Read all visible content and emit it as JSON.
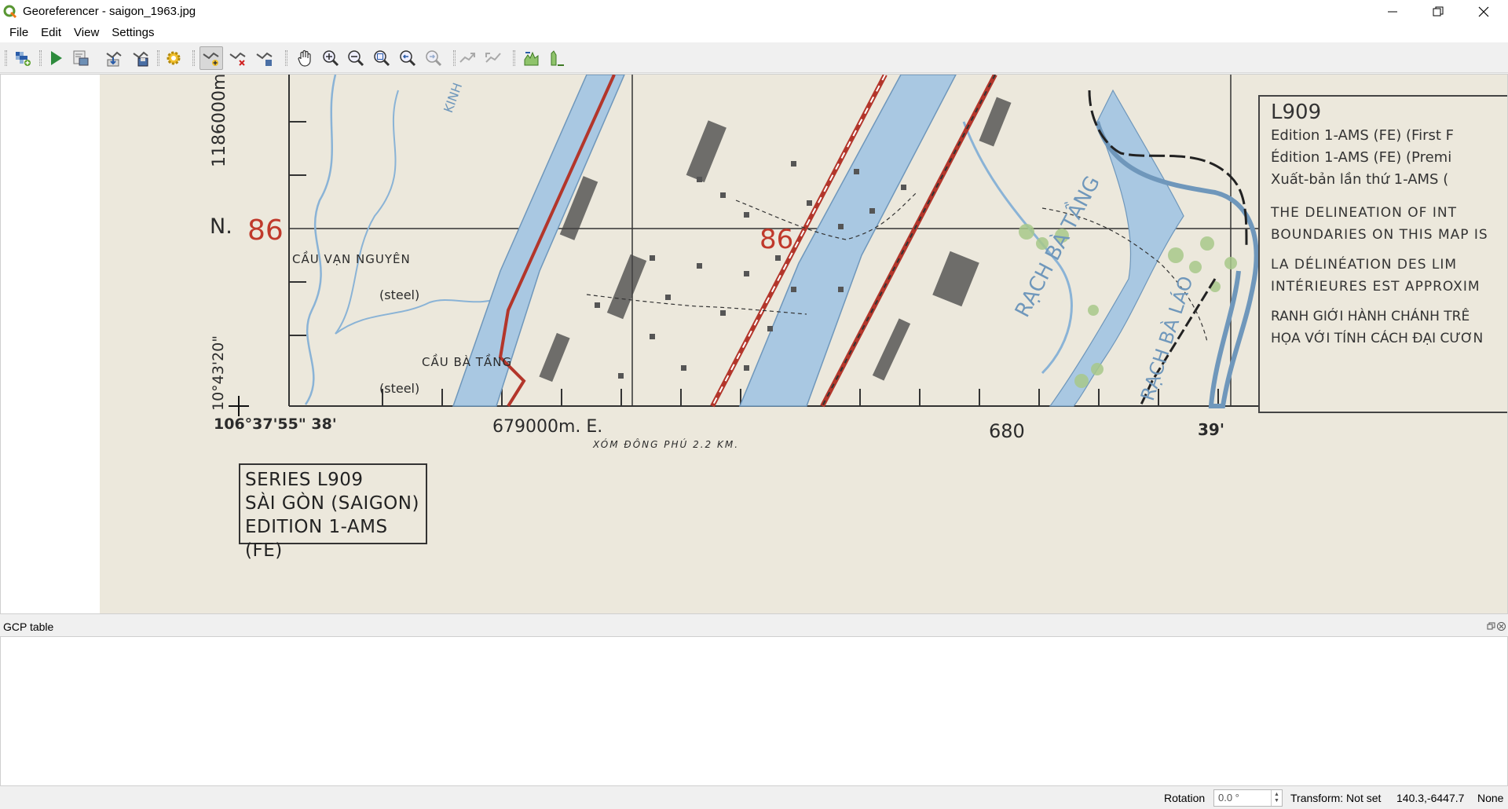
{
  "window": {
    "title": "Georeferencer - saigon_1963.jpg"
  },
  "menu": [
    "File",
    "Edit",
    "View",
    "Settings"
  ],
  "toolbar": {
    "buttons": [
      {
        "name": "open-raster",
        "icon": "open-raster-icon"
      },
      {
        "name": "start-georeferencing",
        "icon": "play-icon"
      },
      {
        "name": "generate-gdal-script",
        "icon": "gdal-script-icon"
      },
      {
        "name": "load-gcp-points",
        "icon": "load-gcp-icon"
      },
      {
        "name": "save-gcp-points",
        "icon": "save-gcp-icon"
      },
      {
        "name": "transformation-settings",
        "icon": "gear-icon"
      },
      {
        "name": "add-point",
        "icon": "add-point-icon",
        "active": true
      },
      {
        "name": "delete-point",
        "icon": "delete-point-icon"
      },
      {
        "name": "move-gcp-point",
        "icon": "move-point-icon"
      },
      {
        "name": "pan",
        "icon": "pan-hand-icon"
      },
      {
        "name": "zoom-in",
        "icon": "zoom-in-icon"
      },
      {
        "name": "zoom-out",
        "icon": "zoom-out-icon"
      },
      {
        "name": "zoom-to-layer",
        "icon": "zoom-layer-icon"
      },
      {
        "name": "zoom-last",
        "icon": "zoom-last-icon"
      },
      {
        "name": "zoom-next",
        "icon": "zoom-next-icon"
      },
      {
        "name": "link-georeferencer",
        "icon": "link-georef-icon"
      },
      {
        "name": "link-qgis",
        "icon": "link-qgis-icon"
      },
      {
        "name": "full-histogram-stretch",
        "icon": "histogram-full-icon"
      },
      {
        "name": "local-histogram-stretch",
        "icon": "histogram-local-icon"
      }
    ]
  },
  "map": {
    "northing_label": "1186000m.",
    "north_letter": "N.",
    "grid_86_left": "86",
    "grid_86_right": "86",
    "cau_van_nguyen": "CẦU VẠN NGUYÊN",
    "steel_1": "(steel)",
    "cau_ba_tang": "CẦU BÀ TẦNG",
    "steel_2": "(steel)",
    "lat_label": "10°43'20\"",
    "lon_label": "106°37'55\"  38'",
    "easting_label": "679000m. E.",
    "xom_dong_phu": "XÓM ĐÔNG PHÚ 2.2 KM.",
    "grid_680": "680",
    "lon_39": "39'",
    "rach_ba_tang": "RẠCH BÀ TẦNG",
    "rach_ba_lao": "RẠCH BÀ LÁO",
    "kinh": "KINH",
    "series_box": [
      "SERIES L909",
      "SÀI GÒN (SAIGON)",
      "EDITION 1-AMS (FE)"
    ],
    "info_box": {
      "title": "L909",
      "lines": [
        "Edition 1-AMS (FE) (First F",
        "Édition 1-AMS (FE) (Premi",
        "Xuất-bản lần thứ 1-AMS (",
        "THE DELINEATION OF INT",
        "BOUNDARIES ON THIS MAP IS",
        "LA DÉLINÉATION DES LIM",
        "INTÉRIEURES EST APPROXIM",
        "RANH GIỚI HÀNH CHÁNH TRÊ",
        "HỌA VỚI TÍNH CÁCH ĐẠI CƯƠN"
      ]
    }
  },
  "gcp_panel": {
    "title": "GCP table"
  },
  "status": {
    "rotation_label": "Rotation",
    "rotation_value": "0.0 °",
    "transform": "Transform: Not set",
    "coords": "140.3,-6447.7",
    "crs": "None"
  },
  "colors": {
    "map_paper": "#ece8dc",
    "water": "#a9c8e2",
    "road_red": "#b3362b",
    "grid_red": "#c0392b",
    "vegetation": "#a8c98a"
  }
}
